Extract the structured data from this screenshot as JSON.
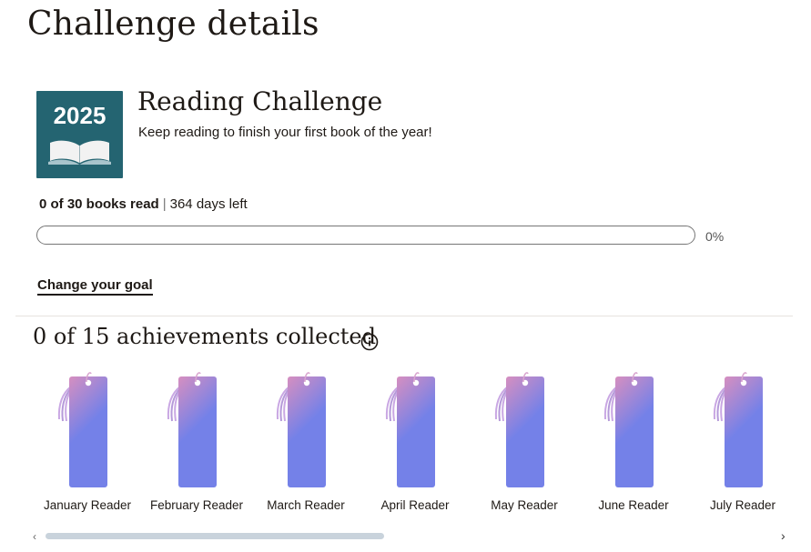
{
  "page": {
    "title": "Challenge details"
  },
  "challenge": {
    "badge_year": "2025",
    "title": "Reading Challenge",
    "subtitle": "Keep reading to finish your first book of the year!",
    "books_read_text": "0 of 30 books read",
    "separator": "|",
    "days_left_text": "364 days left",
    "progress_fraction": 0,
    "progress_percent": "0%",
    "change_goal_label": "Change your goal"
  },
  "achievements": {
    "heading": "0 of 15 achievements collected",
    "items": [
      {
        "label": "January Reader"
      },
      {
        "label": "February Reader"
      },
      {
        "label": "March Reader"
      },
      {
        "label": "April Reader"
      },
      {
        "label": "May Reader"
      },
      {
        "label": "June Reader"
      },
      {
        "label": "July Reader"
      }
    ]
  },
  "colors": {
    "badge_bg": "#246471",
    "bookmark_top": "#d68fc0",
    "bookmark_bottom": "#7481e8",
    "progress_fill": "#409d69"
  },
  "icons": {
    "info": "info-icon",
    "book": "open-book-icon",
    "scroll_left": "chevron-left-icon",
    "scroll_right": "chevron-right-icon"
  }
}
